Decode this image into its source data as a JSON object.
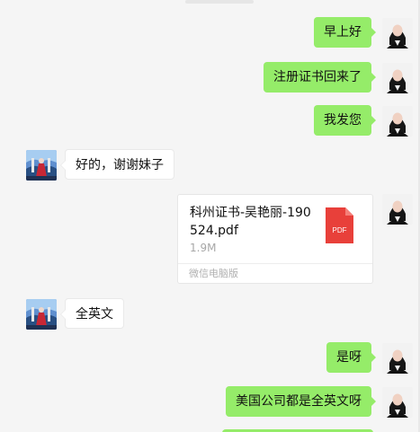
{
  "theme": {
    "background": "#f5f5f5",
    "my_bubble": "#95ec69",
    "their_bubble": "#ffffff",
    "file_icon": "#e8403a"
  },
  "messages": [
    {
      "sender": "me",
      "type": "text",
      "text": "早上好"
    },
    {
      "sender": "me",
      "type": "text",
      "text": "注册证书回来了"
    },
    {
      "sender": "me",
      "type": "text",
      "text": "我发您"
    },
    {
      "sender": "other",
      "type": "text",
      "text": "好的，谢谢妹子"
    },
    {
      "sender": "me",
      "type": "file",
      "file_name": "科州证书-吴艳丽-190524.pdf",
      "file_size": "1.9M",
      "file_type_label": "PDF",
      "source": "微信电脑版"
    },
    {
      "sender": "other",
      "type": "text",
      "text": "全英文"
    },
    {
      "sender": "me",
      "type": "text",
      "text": "是呀"
    },
    {
      "sender": "me",
      "type": "text",
      "text": "美国公司都是全英文呀"
    }
  ],
  "icons": {
    "my_avatar": "woman-portrait-avatar",
    "contact_avatar": "travel-photo-avatar",
    "file_type": "pdf-file-icon"
  }
}
